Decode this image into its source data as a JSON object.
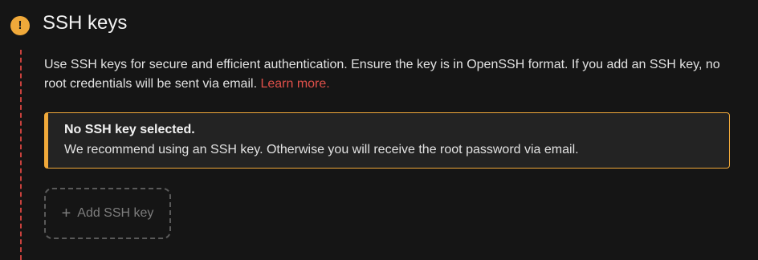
{
  "section": {
    "status_icon": "warning-icon",
    "status_glyph": "!",
    "title": "SSH keys",
    "description": "Use SSH keys for secure and efficient authentication. Ensure the key is in OpenSSH format. If you add an SSH key, no root credentials will be sent via email.",
    "learn_more": "Learn more."
  },
  "notice": {
    "title": "No SSH key selected.",
    "text": "We recommend using an SSH key. Otherwise you will receive the root password via email."
  },
  "add_button": {
    "icon": "plus-icon",
    "icon_glyph": "+",
    "label": "Add SSH key"
  },
  "colors": {
    "background": "#151515",
    "warning": "#f0a93a",
    "link": "#e0504a",
    "step_line": "#c9413d"
  }
}
